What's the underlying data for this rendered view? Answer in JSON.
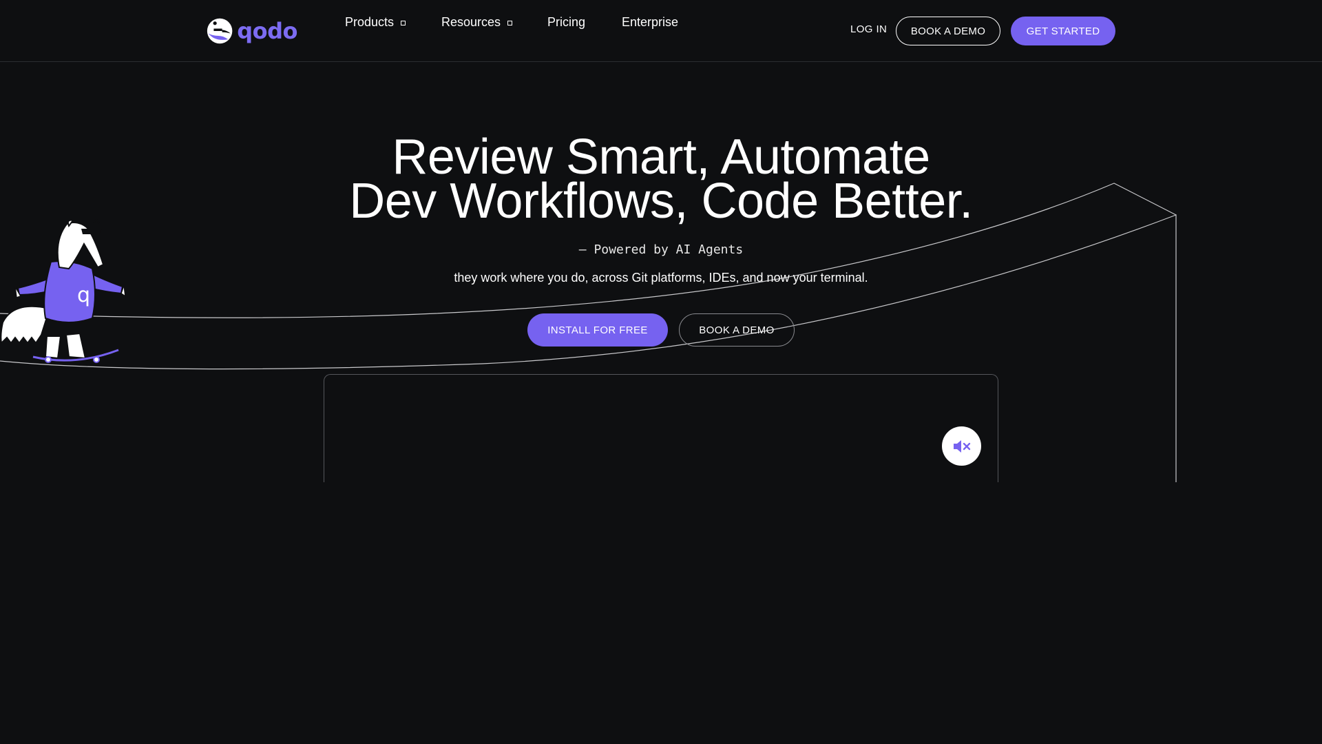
{
  "brand": {
    "name": "qodo",
    "accent_color": "#7662f0",
    "logo_icon": "anteater-logo-icon"
  },
  "header": {
    "nav": [
      {
        "label": "Products",
        "has_dropdown": true
      },
      {
        "label": "Resources",
        "has_dropdown": true
      },
      {
        "label": "Pricing",
        "has_dropdown": false
      },
      {
        "label": "Enterprise",
        "has_dropdown": false
      }
    ],
    "login_label": "LOG IN",
    "book_demo_label": "BOOK A DEMO",
    "get_started_label": "GET STARTED"
  },
  "hero": {
    "title_line1": "Review Smart, Automate",
    "title_line2": "Dev Workflows, Code Better.",
    "powered_by": "– Powered by AI Agents",
    "subtitle": "they work where you do, across Git platforms, IDEs, and now your terminal.",
    "install_label": "INSTALL FOR FREE",
    "book_demo_label": "BOOK A DEMO"
  },
  "media": {
    "mute_icon": "speaker-muted-icon",
    "mascot": "skateboarding-anteater-mascot"
  },
  "colors": {
    "background": "#0e0f11",
    "text": "#ffffff",
    "divider": "#2b2d31"
  }
}
